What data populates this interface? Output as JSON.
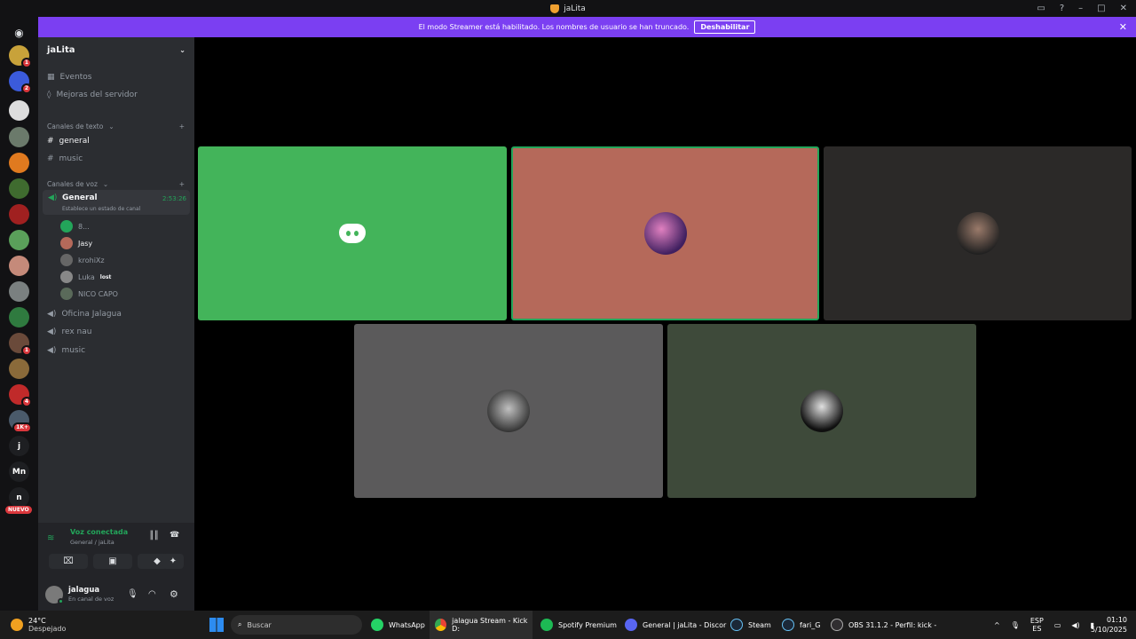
{
  "window": {
    "title": "jaLita"
  },
  "banner": {
    "text": "El modo Streamer está habilitado. Los nombres de usuario se han truncado.",
    "button": "Deshabilitar"
  },
  "rail": {
    "servers": [
      {
        "label": "",
        "badge": "1",
        "color": "#c8a23a"
      },
      {
        "label": "",
        "badge": "2",
        "color": "#3b5bdb"
      },
      {
        "label": "",
        "badge": "",
        "color": "#dddddd"
      },
      {
        "label": "",
        "badge": "",
        "color": "#6b7a6b"
      },
      {
        "label": "",
        "badge": "",
        "color": "#e07a1f"
      },
      {
        "label": "",
        "badge": "",
        "color": "#3f6b2f"
      },
      {
        "label": "",
        "badge": "",
        "color": "#a02020"
      },
      {
        "label": "",
        "badge": "",
        "color": "#5aa05a"
      },
      {
        "label": "",
        "badge": "",
        "color": "#c58a7a"
      },
      {
        "label": "",
        "badge": "",
        "color": "#7a8080"
      },
      {
        "label": "",
        "badge": "",
        "color": "#2f7a3f"
      },
      {
        "label": "",
        "badge": "1",
        "color": "#6a4a3a"
      },
      {
        "label": "",
        "badge": "",
        "color": "#8a6a3a"
      },
      {
        "label": "",
        "badge": "4",
        "color": "#c02a2a"
      },
      {
        "label": "",
        "badge": "1K+",
        "color": "#4a5a6a"
      },
      {
        "label": "j",
        "badge": "",
        "color": "#1e1f22"
      },
      {
        "label": "Mn",
        "badge": "",
        "color": "#1e1f22"
      },
      {
        "label": "n",
        "badge": "",
        "color": "#1e1f22"
      }
    ],
    "new_badge": "NUEVO"
  },
  "sidebar": {
    "server_name": "jaLita",
    "events": "Eventos",
    "boosts": "Mejoras del servidor",
    "text_category": "Canales de texto",
    "text_channels": [
      "general",
      "music"
    ],
    "voice_category": "Canales de voz",
    "voice_active": {
      "name": "General",
      "time": "2:53:26",
      "status": "Establece un estado de canal"
    },
    "voice_users": [
      {
        "name": "8...",
        "tag": ""
      },
      {
        "name": "Jasy",
        "tag": ""
      },
      {
        "name": "krohiXz",
        "tag": ""
      },
      {
        "name": "Luka",
        "tag": "lost"
      },
      {
        "name": "NICO CAPO",
        "tag": ""
      }
    ],
    "voice_channels": [
      "Oficina Jalagua",
      "rex nau",
      "music"
    ]
  },
  "voice_panel": {
    "status": "Voz conectada",
    "channel": "General / jaLita"
  },
  "user_panel": {
    "name": "jalagua",
    "status": "En canal de voz"
  },
  "colors": {
    "tile1": "#43b45a",
    "tile2": "#b5695a",
    "tile3": "#2b2928",
    "tile4": "#5b5a5b",
    "tile5": "#3e4a3a"
  },
  "taskbar": {
    "weather_temp": "24°C",
    "weather_desc": "Despejado",
    "search": "Buscar",
    "apps": [
      "WhatsApp",
      "jalagua Stream - Kick D:",
      "Spotify Premium",
      "General | jaLita - Discor",
      "Steam",
      "fari_G",
      "OBS 31.1.2 - Perfil: kick -"
    ],
    "lang": "ESP",
    "lang2": "ES",
    "time": "01:10",
    "date": "5/10/2025"
  }
}
